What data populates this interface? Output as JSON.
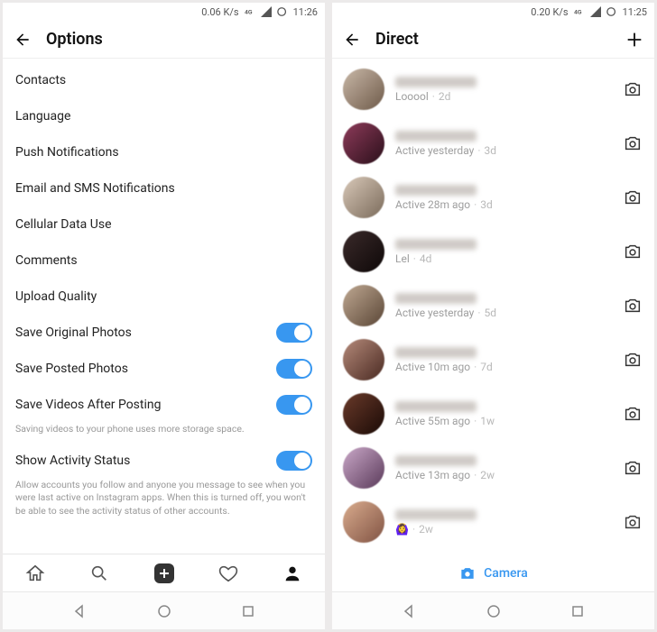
{
  "left": {
    "status": {
      "speed": "0.06 K/s",
      "net": "4G",
      "time": "11:26"
    },
    "title": "Options",
    "items": [
      {
        "label": "Contacts",
        "toggle": false
      },
      {
        "label": "Language",
        "toggle": false
      },
      {
        "label": "Push Notifications",
        "toggle": false
      },
      {
        "label": "Email and SMS Notifications",
        "toggle": false
      },
      {
        "label": "Cellular Data Use",
        "toggle": false
      },
      {
        "label": "Comments",
        "toggle": false
      },
      {
        "label": "Upload Quality",
        "toggle": false
      },
      {
        "label": "Save Original Photos",
        "toggle": true,
        "on": true
      },
      {
        "label": "Save Posted Photos",
        "toggle": true,
        "on": true
      },
      {
        "label": "Save Videos After Posting",
        "toggle": true,
        "on": true,
        "note": "Saving videos to your phone uses more storage space."
      },
      {
        "label": "Show Activity Status",
        "toggle": true,
        "on": true,
        "note": "Allow accounts you follow and anyone you message to see when you were last active on Instagram apps. When this is turned off, you won't be able to see the activity status of other accounts."
      }
    ]
  },
  "right": {
    "status": {
      "speed": "0.20 K/s",
      "net": "4G",
      "time": "11:25"
    },
    "title": "Direct",
    "camera_label": "Camera",
    "threads": [
      {
        "subtitle": "Looool",
        "time": "2d",
        "av": "linear-gradient(135deg,#c9b8a8,#6e5a49)"
      },
      {
        "subtitle": "Active yesterday",
        "time": "3d",
        "av": "linear-gradient(135deg,#8e3b5a,#2a0f1a)"
      },
      {
        "subtitle": "Active 28m ago",
        "time": "3d",
        "av": "linear-gradient(135deg,#d8c8b8,#7a6a5a)"
      },
      {
        "subtitle": "Lel",
        "time": "4d",
        "av": "linear-gradient(135deg,#3a2a2a,#0e0808)"
      },
      {
        "subtitle": "Active yesterday",
        "time": "5d",
        "av": "linear-gradient(135deg,#bfa892,#5a4636)"
      },
      {
        "subtitle": "Active 10m ago",
        "time": "7d",
        "av": "linear-gradient(135deg,#b58a7a,#4a2a22)"
      },
      {
        "subtitle": "Active 55m ago",
        "time": "1w",
        "av": "linear-gradient(135deg,#6a3a2a,#1a0a06)"
      },
      {
        "subtitle": "Active 13m ago",
        "time": "2w",
        "av": "linear-gradient(135deg,#caa8c8,#5a3a5a)"
      },
      {
        "subtitle": "🙆‍♀️",
        "time": "2w",
        "av": "linear-gradient(135deg,#d8a888,#7a4a3a)"
      }
    ]
  }
}
